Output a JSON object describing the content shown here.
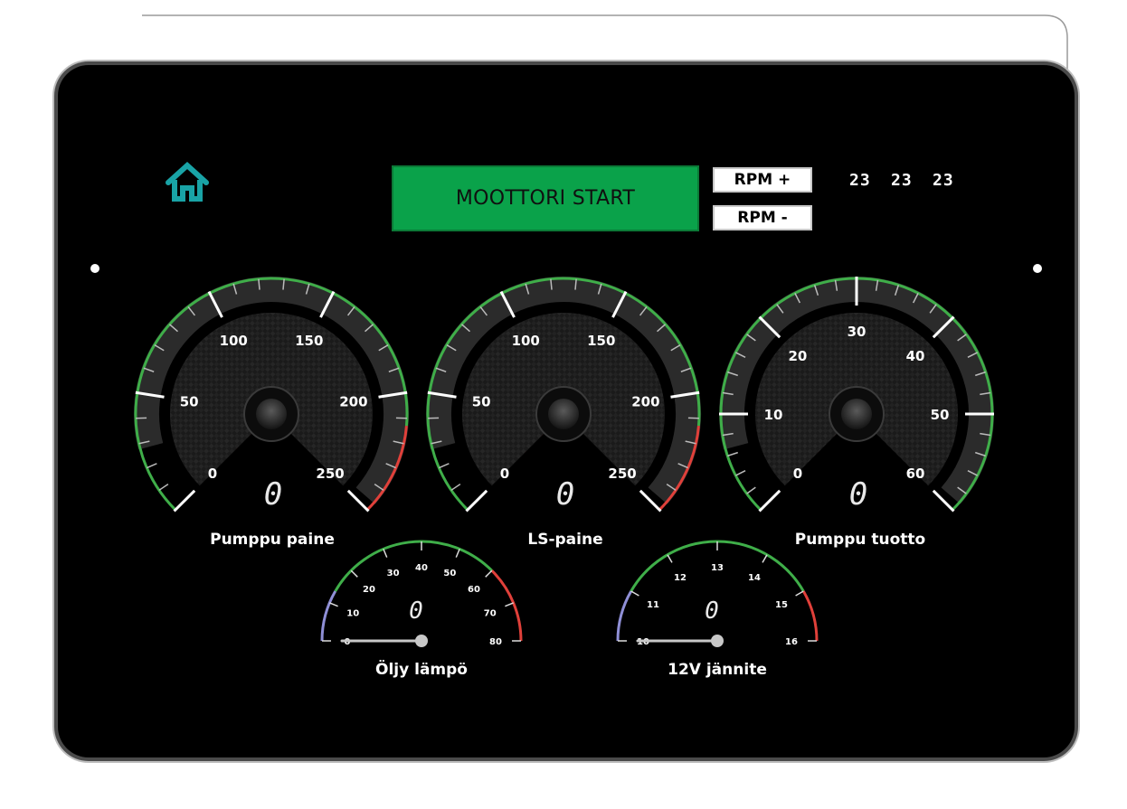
{
  "header": {
    "start_label": "MOOTTORI START",
    "rpm_plus_label": "RPM +",
    "rpm_minus_label": "RPM -",
    "counters": [
      "23",
      "23",
      "23"
    ]
  },
  "gauges": {
    "pump_pressure": {
      "label": "Pumppu paine",
      "ticks": [
        "0",
        "50",
        "100",
        "150",
        "200",
        "250"
      ],
      "value": 0,
      "readout": "0"
    },
    "ls_pressure": {
      "label": "LS-paine",
      "ticks": [
        "0",
        "50",
        "100",
        "150",
        "200",
        "250"
      ],
      "value": 0,
      "readout": "0"
    },
    "pump_output": {
      "label": "Pumppu tuotto",
      "ticks": [
        "0",
        "10",
        "20",
        "30",
        "40",
        "50",
        "60"
      ],
      "value": 0,
      "readout": "0"
    },
    "oil_temp": {
      "label": "Öljy lämpö",
      "ticks": [
        "0",
        "10",
        "20",
        "30",
        "40",
        "50",
        "60",
        "70",
        "80"
      ],
      "value": 0,
      "readout": "0"
    },
    "voltage": {
      "label": "12V jännite",
      "ticks": [
        "10",
        "11",
        "12",
        "13",
        "14",
        "15",
        "16"
      ],
      "value": 10,
      "readout": "0"
    }
  },
  "colors": {
    "start_button": "#0aa24a",
    "home_icon": "#19a3a6",
    "gauge_green": "#3fae49",
    "gauge_red": "#e0403a",
    "gauge_blue": "#8f8fd6",
    "needle": "#d42020"
  },
  "icons": {
    "home": "home-icon"
  }
}
